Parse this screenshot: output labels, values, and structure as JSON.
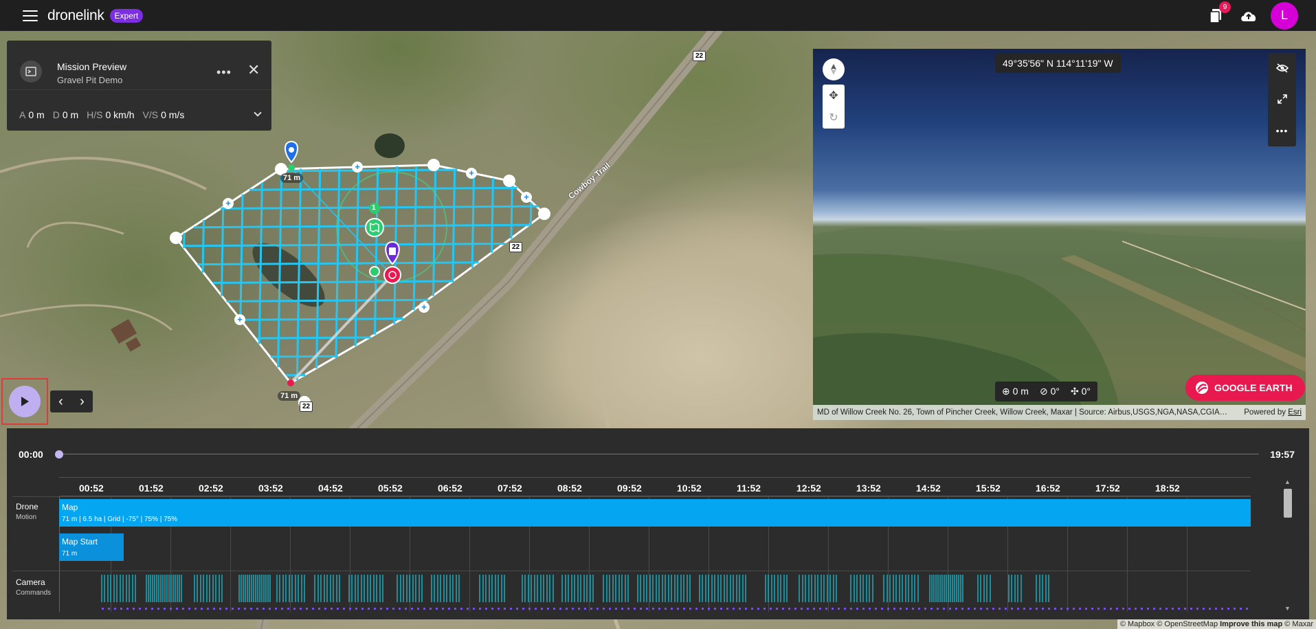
{
  "app": {
    "brand": "dronelink",
    "tier_badge": "Expert",
    "notification_count": "9",
    "avatar_letter": "L"
  },
  "mission": {
    "title": "Mission Preview",
    "subtitle": "Gravel Pit Demo",
    "stats": [
      {
        "label": "A",
        "value": "0 m"
      },
      {
        "label": "D",
        "value": "0 m"
      },
      {
        "label": "H/S",
        "value": "0 km/h"
      },
      {
        "label": "V/S",
        "value": "0 m/s"
      }
    ]
  },
  "map": {
    "road_shield_labels": [
      "22",
      "22",
      "22"
    ],
    "road_name": "Cowboy Trail",
    "altitude_labels": [
      "71 m",
      "71 m"
    ],
    "step_number": "1",
    "attribution": "© Mapbox © OpenStreetMap",
    "improve_link": "Improve this map",
    "attribution_tail": "© Maxar"
  },
  "view3d": {
    "coordinates": "49°35'56\" N 114°11'19\" W",
    "altitude": "0 m",
    "heading": "0°",
    "gimbal": "0°",
    "google_earth_label": "GOOGLE EARTH",
    "attribution": "MD of Willow Creek No. 26, Town of Pincher Creek, Willow Creek, Maxar | Source: Airbus,USGS,NGA,NASA,CGIA…",
    "powered_by": "Powered by",
    "powered_by_link": "Esri"
  },
  "timeline": {
    "start_time": "00:00",
    "end_time": "19:57",
    "ticks": [
      "00:52",
      "01:52",
      "02:52",
      "03:52",
      "04:52",
      "05:52",
      "06:52",
      "07:52",
      "08:52",
      "09:52",
      "10:52",
      "11:52",
      "12:52",
      "13:52",
      "14:52",
      "15:52",
      "16:52",
      "17:52",
      "18:52"
    ],
    "rows": [
      {
        "title": "Drone",
        "sub": "Motion"
      },
      {
        "title": "Camera",
        "sub": "Commands"
      }
    ],
    "map_segment": {
      "title": "Map",
      "detail": "71 m | 6.5 ha | Grid | -75° | 75% | 75%"
    },
    "map_start_segment": {
      "title": "Map Start",
      "detail": "71 m"
    },
    "colors": {
      "map_segment": "#04a6f2",
      "camera_marks": "#19b6c8",
      "accent": "#7b2fe0",
      "google_earth": "#e8194f"
    }
  }
}
